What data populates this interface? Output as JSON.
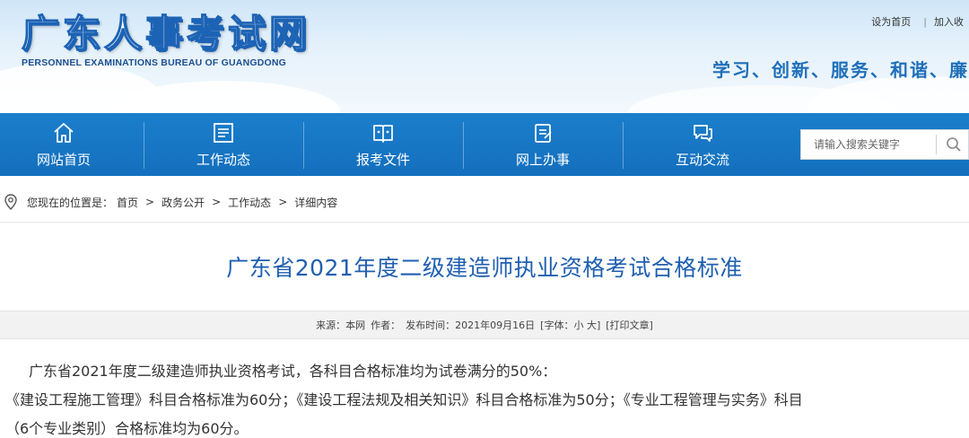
{
  "header": {
    "site_title": "广东人事考试网",
    "site_subtitle": "PERSONNEL EXAMINATIONS BUREAU OF GUANGDONG",
    "top_links": [
      "设为首页",
      "加入收"
    ],
    "slogan": "学习、创新、服务、和谐、廉"
  },
  "nav": {
    "items": [
      {
        "label": "网站首页",
        "icon": "home-icon"
      },
      {
        "label": "工作动态",
        "icon": "news-board-icon"
      },
      {
        "label": "报考文件",
        "icon": "book-icon"
      },
      {
        "label": "网上办事",
        "icon": "clipboard-icon"
      },
      {
        "label": "互动交流",
        "icon": "chat-icon"
      }
    ],
    "search_placeholder": "请输入搜索关键字"
  },
  "breadcrumb": {
    "prefix": "您现在的位置是：",
    "items": [
      "首页",
      "政务公开",
      "工作动态",
      "详细内容"
    ],
    "separator": ">"
  },
  "article": {
    "title": "广东省2021年度二级建造师执业资格考试合格标准",
    "meta": {
      "source": "来源：本网",
      "author": "作者：",
      "published": "发布时间：2021年09月16日",
      "font_size": "[字体：小 大]",
      "print": "[打印文章]"
    },
    "paragraphs": [
      "广东省2021年度二级建造师执业资格考试，各科目合格标准均为试卷满分的50%：",
      "《建设工程施工管理》科目合格标准为60分；《建设工程法规及相关知识》科目合格标准为50分；《专业工程管理与实务》科目",
      "（6个专业类别）合格标准均为60分。"
    ]
  },
  "colors": {
    "nav_blue": "#1b7fcc",
    "title_blue": "#1f5fb0",
    "slogan_blue": "#1f6fb9"
  }
}
